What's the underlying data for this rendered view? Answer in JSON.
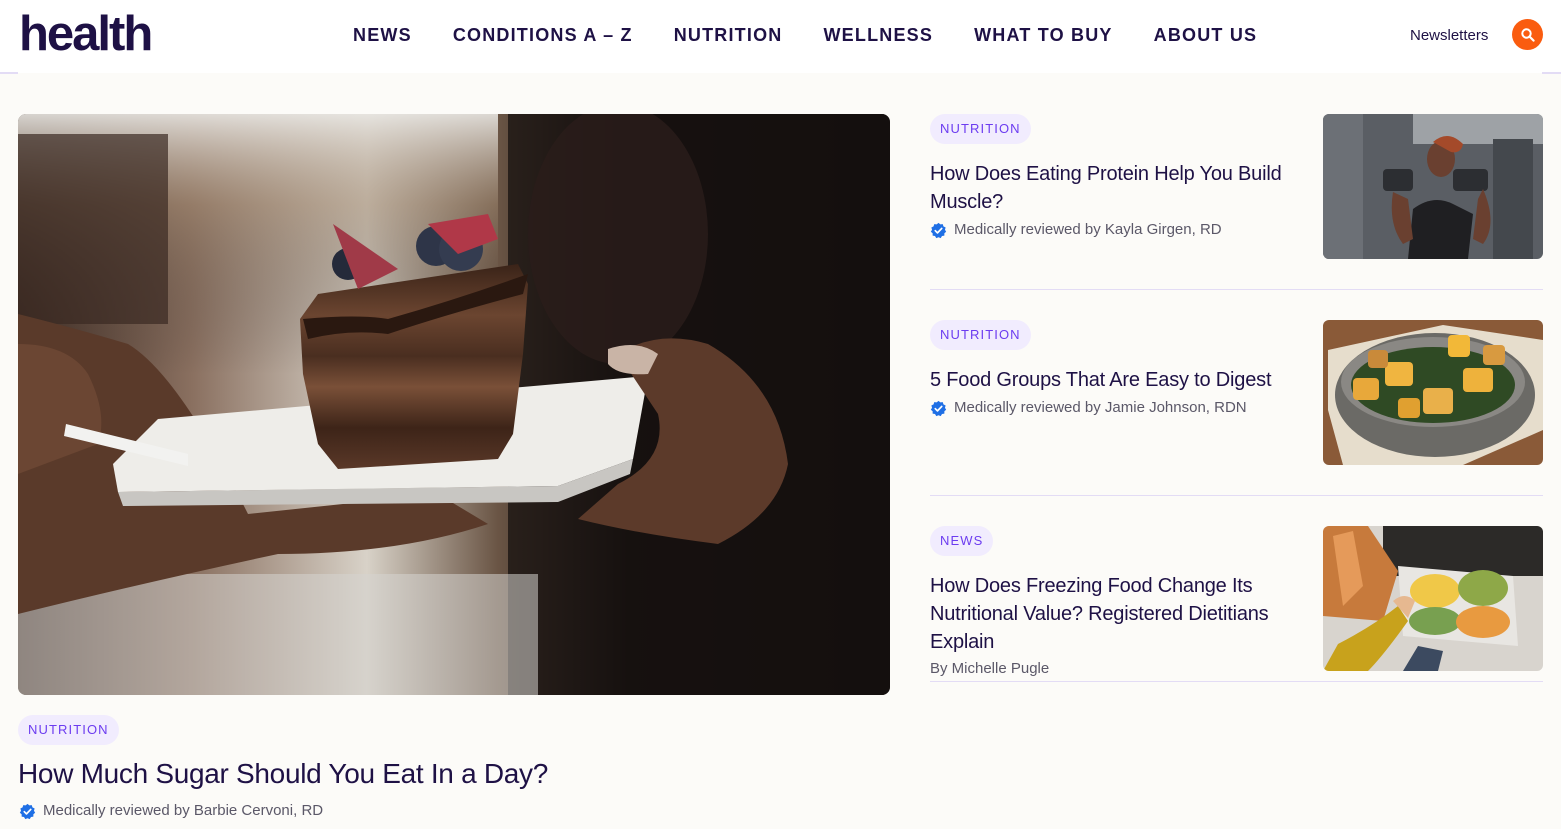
{
  "header": {
    "logo": "health",
    "nav": [
      "NEWS",
      "CONDITIONS A – Z",
      "NUTRITION",
      "WELLNESS",
      "WHAT TO BUY",
      "ABOUT US"
    ],
    "newsletters": "Newsletters",
    "search_icon": "search-icon"
  },
  "colors": {
    "brand_dark": "#1e1145",
    "accent_orange": "#fa5c0f",
    "tag_bg": "#f1ecfe",
    "tag_text": "#6c3cf0",
    "verified_blue": "#1f6fe5",
    "page_bg": "#fcfbf8"
  },
  "hero": {
    "image_alt": "Hands holding a plate with a slice of layered chocolate cake topped with blueberries",
    "tag": "NUTRITION",
    "title": "How Much Sugar Should You Eat In a Day?",
    "byline": "Medically reviewed by Barbie Cervoni, RD",
    "verified": true
  },
  "cards": [
    {
      "tag": "NUTRITION",
      "title": "How Does Eating Protein Help You Build Muscle?",
      "byline": "Medically reviewed by Kayla Girgen, RD",
      "verified": true,
      "image_alt": "Woman lifting dumbbells in a gym"
    },
    {
      "tag": "NUTRITION",
      "title": "5 Food Groups That Are Easy to Digest",
      "byline": "Medically reviewed by Jamie Johnson, RDN",
      "verified": true,
      "image_alt": "Bowl of roasted potatoes with greens"
    },
    {
      "tag": "NEWS",
      "title": "How Does Freezing Food Change Its Nutritional Value? Registered Dietitians Explain",
      "byline": "By Michelle Pugle",
      "verified": false,
      "image_alt": "Person holding tray of frozen vegetables by open freezer"
    }
  ]
}
